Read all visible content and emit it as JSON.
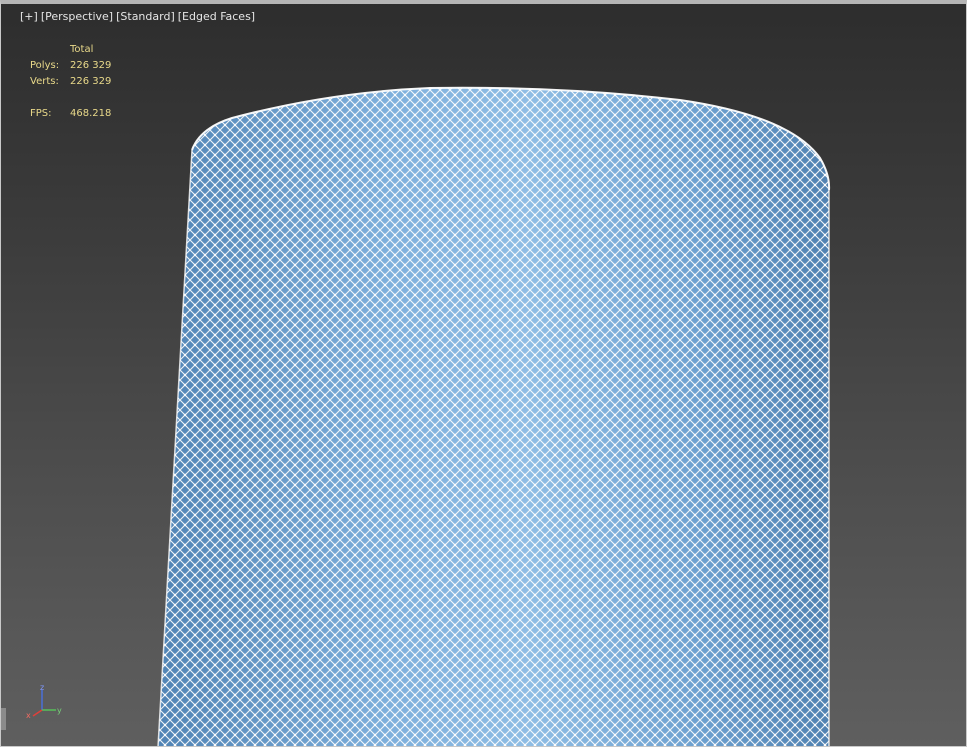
{
  "viewport": {
    "labels": {
      "plus": "[+]",
      "view": "[Perspective]",
      "shading": "[Standard]",
      "edges": "[Edged Faces]"
    },
    "stats": {
      "header": "Total",
      "polys_label": "Polys:",
      "polys_value": "226 329",
      "verts_label": "Verts:",
      "verts_value": "226 329",
      "fps_label": "FPS:",
      "fps_value": "468.218"
    },
    "gizmo": {
      "x": "x",
      "y": "y",
      "z": "z"
    },
    "colors": {
      "mesh_fill": "#5f94c4",
      "mesh_highlight": "#9ec7ea",
      "wire": "#ffffff",
      "stats_text": "#e9d98a",
      "label_text": "#e6e6e6",
      "axis_x": "#e0403a",
      "axis_y": "#56c25a",
      "axis_z": "#4a6fd8"
    }
  }
}
